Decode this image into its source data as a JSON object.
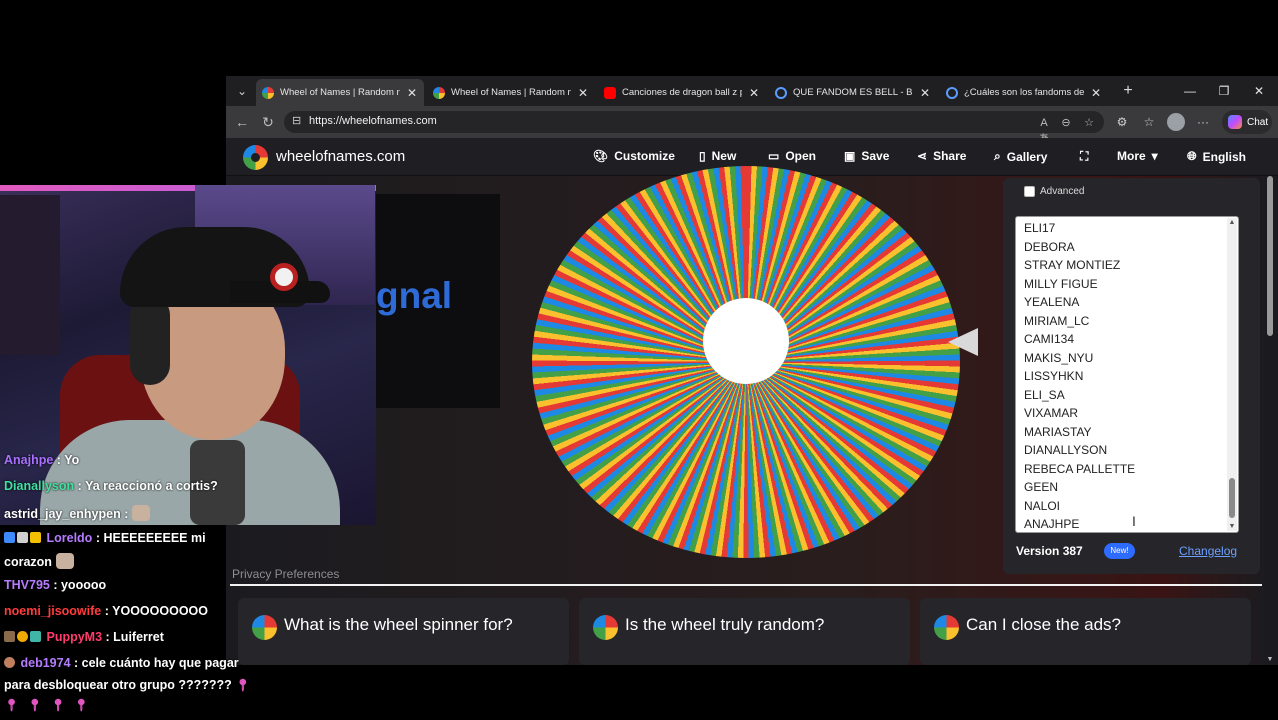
{
  "browser": {
    "tabs": [
      {
        "title": "Wheel of Names | Random nam",
        "favicon_color": "#4285f4",
        "active": true
      },
      {
        "title": "Wheel of Names | Random nam",
        "favicon_color": "#4285f4",
        "active": false
      },
      {
        "title": "Canciones de dragon ball z pel",
        "favicon_color": "#ff0000",
        "active": false
      },
      {
        "title": "QUE FANDOM ES BELL - Búsqu",
        "favicon_color": "#5b9cff",
        "active": false
      },
      {
        "title": "¿Cuáles son los fandoms de K",
        "favicon_color": "#5b9cff",
        "active": false
      }
    ],
    "url": "https://wheelofnames.com",
    "copilot_label": "Chat"
  },
  "site": {
    "name": "wheelofnames.com",
    "menu": [
      "Customize",
      "New",
      "Open",
      "Save",
      "Share",
      "Gallery",
      "",
      "More",
      "English"
    ]
  },
  "ad": {
    "text": "gnal"
  },
  "panel": {
    "advanced_label": "Advanced",
    "entries": [
      "ELI17",
      "DEBORA",
      "STRAY MONTIEZ",
      "MILLY FIGUE",
      "YEALENA",
      "MIRIAM_LC",
      "CAMI134",
      "MAKIS_NYU",
      "LISSYHKN",
      "ELI_SA",
      "VIXAMAR",
      "MARIASTAY",
      "DIANALLYSON",
      "REBECA PALLETTE",
      "GEEN",
      "NALOI",
      "ANAJHPE"
    ],
    "version": "Version 387",
    "new_badge": "New!",
    "changelog": "Changelog"
  },
  "privacy": "Privacy Preferences",
  "faq": [
    "What is the wheel spinner for?",
    "Is the wheel truly random?",
    "Can I close the ads?"
  ],
  "chat": [
    {
      "user": "Anajhpe",
      "color": "#a970ff",
      "msg": ": Yo"
    },
    {
      "user": "Dianallyson",
      "color": "#40e0a0",
      "msg": ": Ya reaccionó a cortis?"
    },
    {
      "user": "astrid_jay_enhypen",
      "color": "#ffffff",
      "msg": ":"
    },
    {
      "user": "Loreldo",
      "color": "#b67cff",
      "msg": ": HEEEEEEEEE mi"
    },
    {
      "user": "",
      "color": "#ffffff",
      "msg": "corazon"
    },
    {
      "user": "THV795",
      "color": "#b67cff",
      "msg": ": yooooo"
    },
    {
      "user": "noemi_jisoowife",
      "color": "#ff3b3b",
      "msg": ": YOOOOOOOOO"
    },
    {
      "user": "PuppyM3",
      "color": "#ff3b6b",
      "msg": ": Luiferret"
    },
    {
      "user": "deb1974",
      "color": "#b67cff",
      "msg": ": cele cuánto hay que pagar"
    },
    {
      "user": "",
      "color": "#ffffff",
      "msg": "para desbloquear otro grupo ???????"
    }
  ],
  "colors": {
    "accent": "#2e6bff",
    "wheel": [
      "#e53935",
      "#fbc02d",
      "#43a047",
      "#1e88e5"
    ]
  }
}
